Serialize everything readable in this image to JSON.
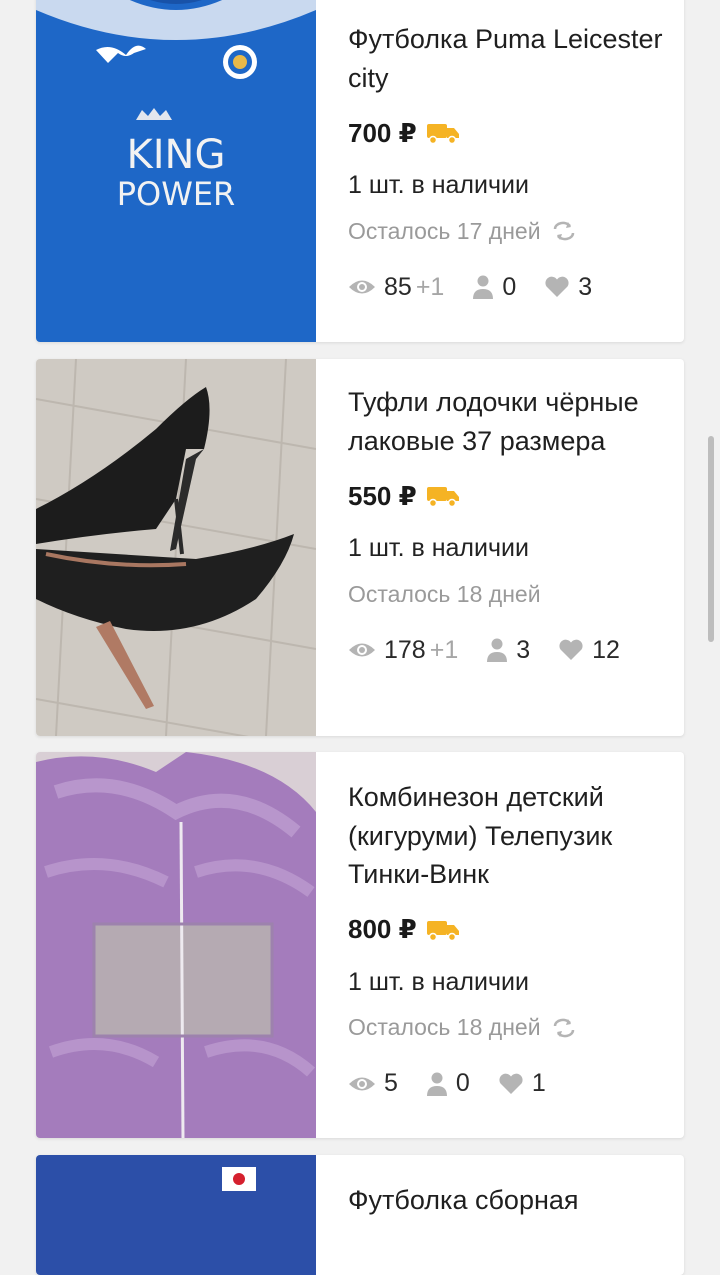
{
  "listings": [
    {
      "title": "Футболка Puma Leicester city",
      "price": "700 ₽",
      "stock": "1 шт. в наличии",
      "expires": "Осталось 17 дней",
      "views": "85",
      "views_delta": "+1",
      "contacts": "0",
      "favorites": "3",
      "image_text_1": "KING",
      "image_text_2": "POWER"
    },
    {
      "title": "Туфли лодочки чёрные лаковые 37 размера",
      "price": "550 ₽",
      "stock": "1 шт. в наличии",
      "expires": "Осталось 18 дней",
      "views": "178",
      "views_delta": "+1",
      "contacts": "3",
      "favorites": "12"
    },
    {
      "title": "Комбинезон детский (кигуруми) Телепузик Тинки-Винк",
      "price": "800 ₽",
      "stock": "1 шт. в наличии",
      "expires": "Осталось 18 дней",
      "views": "5",
      "contacts": "0",
      "favorites": "1"
    },
    {
      "title": "Футболка сборная"
    }
  ],
  "icons": {
    "delivery": "truck-icon",
    "renew": "renew-icon",
    "views": "eye-icon",
    "contacts": "person-icon",
    "favorites": "heart-icon"
  },
  "colors": {
    "accent": "#f5b324",
    "muted": "#a6a6a6"
  }
}
